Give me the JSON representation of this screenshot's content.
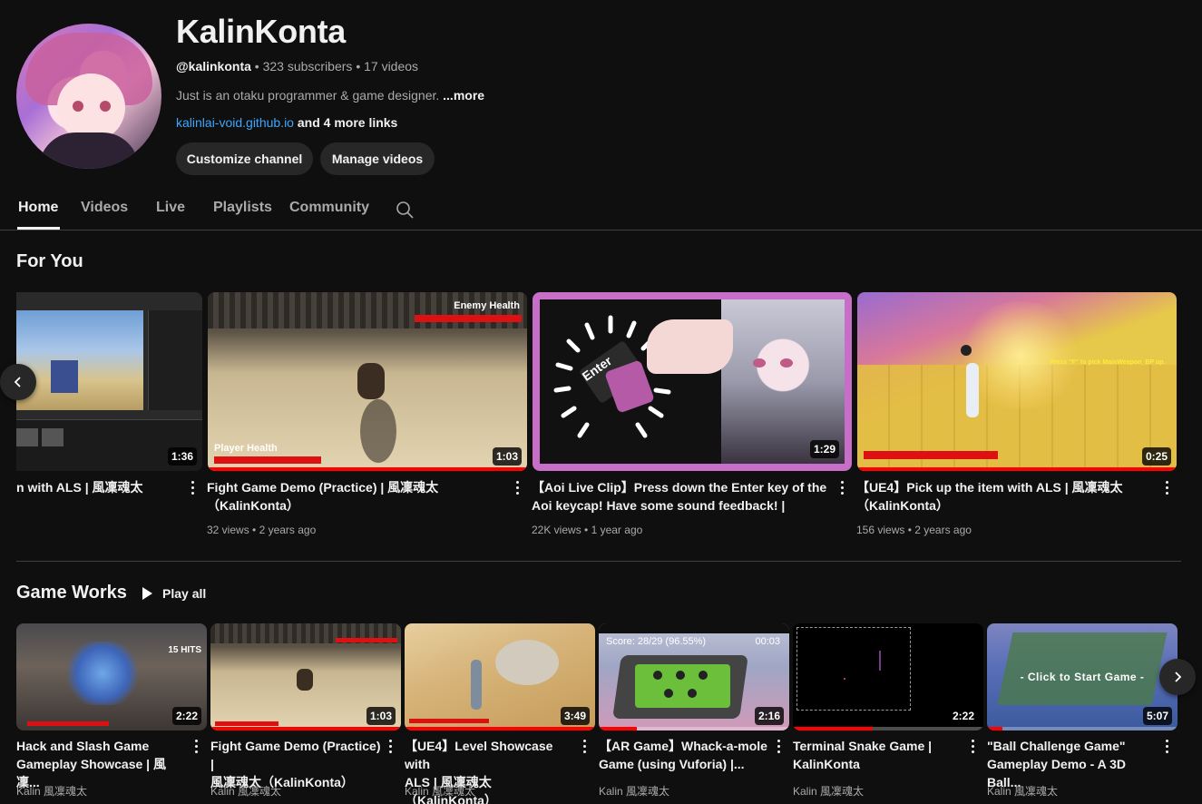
{
  "channel": {
    "name": "KalinKonta",
    "handle": "@kalinkonta",
    "subscribers": "323 subscribers",
    "videos": "17 videos",
    "description": "Just is an otaku programmer & game designer.",
    "more": "...more",
    "link": "kalinlai-void.github.io",
    "more_links": "and 4 more links",
    "customize_label": "Customize channel",
    "manage_label": "Manage videos"
  },
  "tabs": [
    {
      "label": "Home",
      "active": true
    },
    {
      "label": "Videos"
    },
    {
      "label": "Live"
    },
    {
      "label": "Playlists"
    },
    {
      "label": "Community"
    }
  ],
  "for_you": {
    "title": "For You",
    "videos": [
      {
        "title": "n with ALS | 風凜魂太",
        "views": "",
        "age": "",
        "duration": "1:36"
      },
      {
        "title": "Fight Game Demo (Practice) | 風凜魂太（KalinKonta）",
        "views": "32 views",
        "age": "2 years ago",
        "duration": "1:03",
        "overlay_top": "Enemy Health",
        "overlay_bottom": "Player Health"
      },
      {
        "title": "【Aoi Live Clip】Press down the Enter key of the Aoi keycap! Have some sound feedback! | KalinKonta",
        "views": "22K views",
        "age": "1 year ago",
        "duration": "1:29",
        "key_label": "Enter"
      },
      {
        "title": "【UE4】Pick up the item with ALS | 風凜魂太（KalinKonta）",
        "views": "156 views",
        "age": "2 years ago",
        "duration": "0:25",
        "overlay_hint": "Press \"F\" to pick MainWeapon_BP up."
      }
    ]
  },
  "game_works": {
    "title": "Game Works",
    "play_all": "Play all",
    "videos": [
      {
        "title_l1": "Hack and Slash Game",
        "title_l2": "Gameplay Showcase | 風凜...",
        "channel": "Kalin 風凜魂太",
        "duration": "2:22",
        "overlay": "15 HITS"
      },
      {
        "title_l1": "Fight Game Demo (Practice) |",
        "title_l2": "風凜魂太（KalinKonta）",
        "channel": "Kalin 風凜魂太",
        "duration": "1:03"
      },
      {
        "title_l1": "【UE4】Level Showcase with",
        "title_l2": "ALS | 風凜魂太（KalinKonta）",
        "channel": "Kalin 風凜魂太",
        "duration": "3:49"
      },
      {
        "title_l1": "【AR Game】Whack-a-mole",
        "title_l2": "Game (using Vuforia) |...",
        "channel": "Kalin 風凜魂太",
        "duration": "2:16",
        "overlay": "Score: 28/29 (96.55%)",
        "overlay_timer": "00:03"
      },
      {
        "title_l1": "Terminal Snake Game |",
        "title_l2": "KalinKonta",
        "channel": "Kalin 風凜魂太",
        "duration": "2:22"
      },
      {
        "title_l1": "\"Ball Challenge Game\"",
        "title_l2": "Gameplay Demo - A 3D Ball...",
        "channel": "Kalin 風凜魂太",
        "duration": "5:07",
        "overlay": "- Click to Start Game -"
      }
    ]
  }
}
